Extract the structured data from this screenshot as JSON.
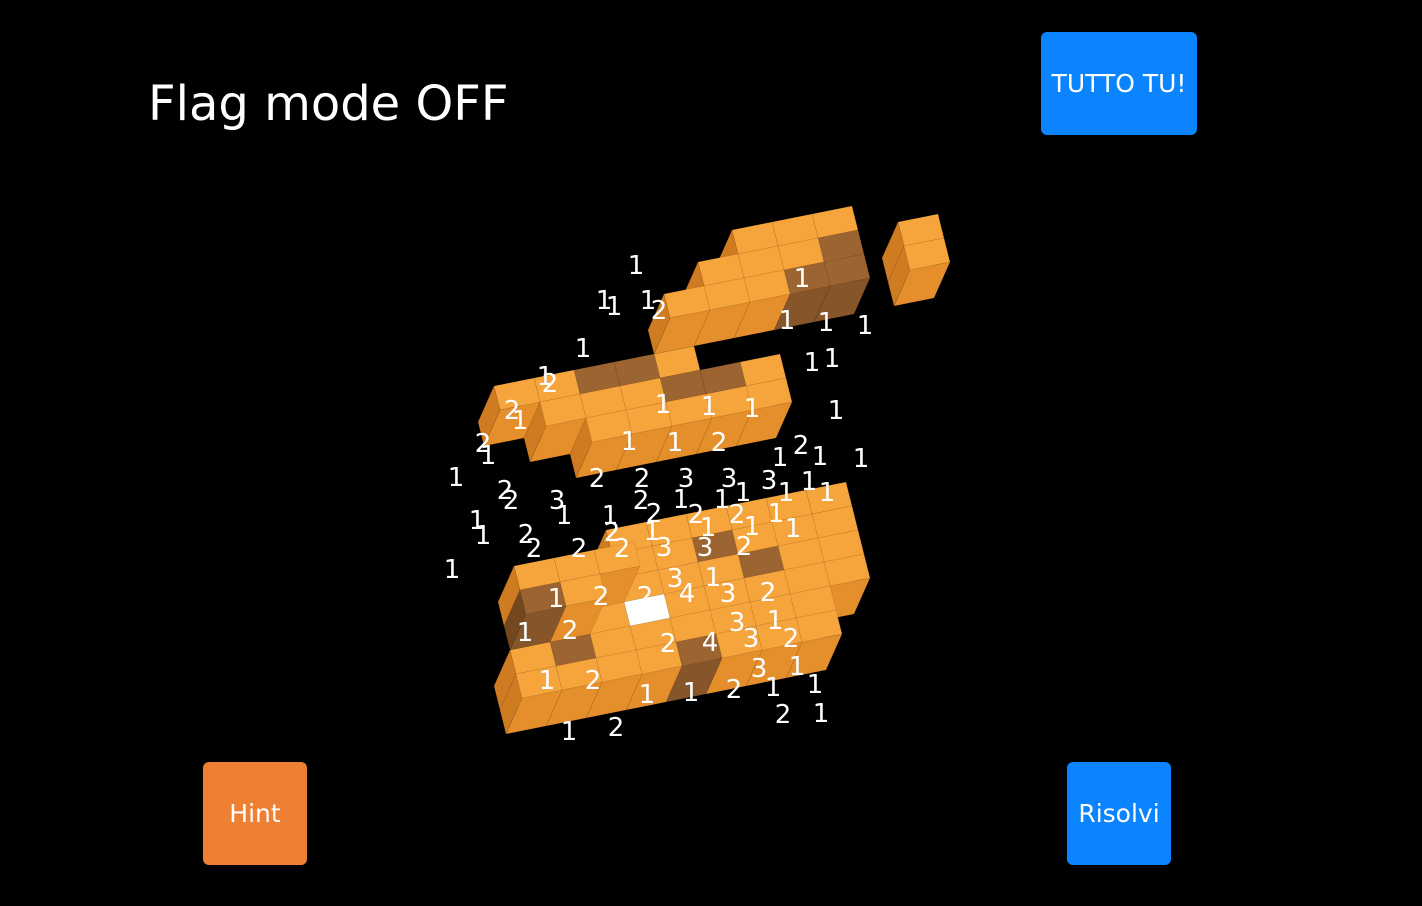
{
  "status": {
    "flag_mode_text": "Flag mode OFF"
  },
  "buttons": {
    "tutto_tu": {
      "label": "TUTTO TU!",
      "color": "#0a84ff"
    },
    "hint": {
      "label": "Hint",
      "color": "#ee8033"
    },
    "risolvi": {
      "label": "Risolvi",
      "color": "#0a84ff"
    }
  },
  "colors": {
    "cube_top": "#f6a43c",
    "cube_left": "#e48f2c",
    "cube_right": "#cf7b22",
    "cube_dark_top": "#9c6430",
    "cube_dark_left": "#86552a",
    "cube_dark_right": "#74481f",
    "revealed_highlight": "#ffffff",
    "number_text": "#ffffff"
  },
  "board": {
    "cubes": [
      [
        3,
        0,
        0,
        "o"
      ],
      [
        4,
        0,
        0,
        "o"
      ],
      [
        5,
        0,
        0,
        "o"
      ],
      [
        6,
        0,
        0,
        "o"
      ],
      [
        7,
        0,
        0,
        "o"
      ],
      [
        8,
        0,
        0,
        "o"
      ],
      [
        3,
        1,
        0,
        "o"
      ],
      [
        4,
        1,
        0,
        "o"
      ],
      [
        5,
        1,
        0,
        "d"
      ],
      [
        6,
        1,
        0,
        "o"
      ],
      [
        7,
        1,
        0,
        "o"
      ],
      [
        8,
        1,
        0,
        "o"
      ],
      [
        2,
        2,
        0,
        "o"
      ],
      [
        3,
        2,
        0,
        "o"
      ],
      [
        4,
        2,
        0,
        "o"
      ],
      [
        5,
        2,
        0,
        "o"
      ],
      [
        6,
        2,
        0,
        "d"
      ],
      [
        7,
        2,
        0,
        "o"
      ],
      [
        8,
        2,
        0,
        "o"
      ],
      [
        1,
        3,
        0,
        "o"
      ],
      [
        2,
        3,
        0,
        "o"
      ],
      [
        3,
        3,
        0,
        "o"
      ],
      [
        4,
        3,
        0,
        "o"
      ],
      [
        5,
        3,
        0,
        "o"
      ],
      [
        6,
        3,
        0,
        "o"
      ],
      [
        7,
        3,
        0,
        "o"
      ],
      [
        8,
        3,
        0,
        "o"
      ],
      [
        0,
        4,
        0,
        "o"
      ],
      [
        1,
        4,
        0,
        "d"
      ],
      [
        2,
        4,
        0,
        "o"
      ],
      [
        3,
        4,
        0,
        "o"
      ],
      [
        4,
        4,
        0,
        "o"
      ],
      [
        5,
        4,
        0,
        "o"
      ],
      [
        6,
        4,
        0,
        "o"
      ],
      [
        7,
        4,
        0,
        "o"
      ],
      [
        0,
        5,
        0,
        "o"
      ],
      [
        1,
        5,
        0,
        "o"
      ],
      [
        2,
        5,
        0,
        "o"
      ],
      [
        3,
        5,
        0,
        "o"
      ],
      [
        4,
        5,
        0,
        "d"
      ],
      [
        5,
        5,
        0,
        "o"
      ],
      [
        6,
        5,
        0,
        "o"
      ],
      [
        7,
        5,
        0,
        "o"
      ],
      [
        0,
        3,
        1,
        "d"
      ],
      [
        1,
        3,
        1,
        "o"
      ],
      [
        0,
        2,
        1,
        "o"
      ],
      [
        1,
        2,
        1,
        "o"
      ],
      [
        2,
        2,
        1,
        "o"
      ],
      [
        2,
        -2,
        2,
        "o"
      ],
      [
        3,
        -2,
        2,
        "o"
      ],
      [
        4,
        -2,
        2,
        "o"
      ],
      [
        5,
        -2,
        2,
        "o"
      ],
      [
        6,
        -2,
        2,
        "o"
      ],
      [
        1,
        -3,
        2,
        "o"
      ],
      [
        2,
        -3,
        2,
        "o"
      ],
      [
        3,
        -3,
        2,
        "o"
      ],
      [
        4,
        -3,
        2,
        "d"
      ],
      [
        5,
        -3,
        2,
        "d"
      ],
      [
        6,
        -3,
        2,
        "o"
      ],
      [
        0,
        -4,
        2,
        "o"
      ],
      [
        1,
        -4,
        2,
        "o"
      ],
      [
        2,
        -4,
        2,
        "d"
      ],
      [
        3,
        -4,
        2,
        "d"
      ],
      [
        4,
        -4,
        2,
        "o"
      ],
      [
        6,
        -7,
        3,
        "o"
      ],
      [
        7,
        -7,
        3,
        "o"
      ],
      [
        8,
        -7,
        3,
        "o"
      ],
      [
        5,
        -6,
        3,
        "o"
      ],
      [
        6,
        -6,
        3,
        "o"
      ],
      [
        7,
        -6,
        3,
        "o"
      ],
      [
        8,
        -6,
        3,
        "d"
      ],
      [
        4,
        -5,
        3,
        "o"
      ],
      [
        5,
        -5,
        3,
        "o"
      ],
      [
        6,
        -5,
        3,
        "o"
      ],
      [
        7,
        -5,
        3,
        "d"
      ],
      [
        8,
        -5,
        3,
        "d"
      ],
      [
        10,
        -6,
        3,
        "o"
      ],
      [
        10,
        -5,
        3,
        "o"
      ]
    ],
    "revealed": [
      3,
      3,
      0
    ],
    "numbers": [
      [
        "1",
        636,
        265
      ],
      [
        "1",
        802,
        278
      ],
      [
        "1",
        604,
        300
      ],
      [
        "1",
        614,
        306
      ],
      [
        "1",
        648,
        300
      ],
      [
        "2",
        659,
        310
      ],
      [
        "1",
        787,
        320
      ],
      [
        "1",
        826,
        322
      ],
      [
        "1",
        865,
        325
      ],
      [
        "1",
        583,
        348
      ],
      [
        "1",
        812,
        362
      ],
      [
        "1",
        832,
        358
      ],
      [
        "1",
        545,
        376
      ],
      [
        "2",
        550,
        383
      ],
      [
        "1",
        663,
        404
      ],
      [
        "1",
        709,
        406
      ],
      [
        "1",
        752,
        408
      ],
      [
        "1",
        836,
        410
      ],
      [
        "2",
        512,
        410
      ],
      [
        "1",
        520,
        420
      ],
      [
        "1",
        629,
        441
      ],
      [
        "1",
        675,
        442
      ],
      [
        "2",
        719,
        442
      ],
      [
        "2",
        801,
        445
      ],
      [
        "2",
        483,
        443
      ],
      [
        "1",
        488,
        455
      ],
      [
        "1",
        780,
        457
      ],
      [
        "1",
        820,
        456
      ],
      [
        "1",
        861,
        458
      ],
      [
        "1",
        456,
        477
      ],
      [
        "2",
        597,
        478
      ],
      [
        "2",
        642,
        478
      ],
      [
        "3",
        686,
        478
      ],
      [
        "3",
        729,
        478
      ],
      [
        "3",
        769,
        480
      ],
      [
        "1",
        809,
        481
      ],
      [
        "1",
        743,
        492
      ],
      [
        "1",
        786,
        492
      ],
      [
        "1",
        827,
        492
      ],
      [
        "2",
        505,
        490
      ],
      [
        "2",
        511,
        500
      ],
      [
        "3",
        557,
        500
      ],
      [
        "2",
        641,
        500
      ],
      [
        "1",
        681,
        499
      ],
      [
        "1",
        722,
        499
      ],
      [
        "2",
        654,
        513
      ],
      [
        "2",
        696,
        514
      ],
      [
        "2",
        737,
        514
      ],
      [
        "1",
        564,
        515
      ],
      [
        "1",
        610,
        515
      ],
      [
        "1",
        776,
        513
      ],
      [
        "1",
        708,
        527
      ],
      [
        "1",
        752,
        526
      ],
      [
        "1",
        793,
        528
      ],
      [
        "1",
        477,
        520
      ],
      [
        "1",
        483,
        535
      ],
      [
        "2",
        526,
        534
      ],
      [
        "2",
        612,
        532
      ],
      [
        "1",
        652,
        531
      ],
      [
        "2",
        534,
        548
      ],
      [
        "2",
        579,
        548
      ],
      [
        "2",
        622,
        548
      ],
      [
        "3",
        664,
        547
      ],
      [
        "3",
        705,
        547
      ],
      [
        "2",
        744,
        546
      ],
      [
        "1",
        452,
        569
      ],
      [
        "3",
        675,
        578
      ],
      [
        "1",
        713,
        577
      ],
      [
        "2",
        601,
        596
      ],
      [
        "2",
        645,
        596
      ],
      [
        "4",
        687,
        593
      ],
      [
        "3",
        728,
        593
      ],
      [
        "2",
        768,
        592
      ],
      [
        "1",
        556,
        598
      ],
      [
        "3",
        737,
        622
      ],
      [
        "1",
        775,
        620
      ],
      [
        "1",
        525,
        632
      ],
      [
        "2",
        570,
        630
      ],
      [
        "3",
        751,
        638
      ],
      [
        "2",
        791,
        638
      ],
      [
        "2",
        668,
        643
      ],
      [
        "4",
        710,
        642
      ],
      [
        "3",
        759,
        668
      ],
      [
        "1",
        797,
        666
      ],
      [
        "1",
        547,
        680
      ],
      [
        "2",
        593,
        680
      ],
      [
        "1",
        647,
        694
      ],
      [
        "1",
        691,
        692
      ],
      [
        "2",
        734,
        689
      ],
      [
        "1",
        773,
        687
      ],
      [
        "1",
        815,
        684
      ],
      [
        "1",
        569,
        731
      ],
      [
        "2",
        616,
        727
      ],
      [
        "2",
        783,
        714
      ],
      [
        "1",
        821,
        713
      ]
    ]
  }
}
